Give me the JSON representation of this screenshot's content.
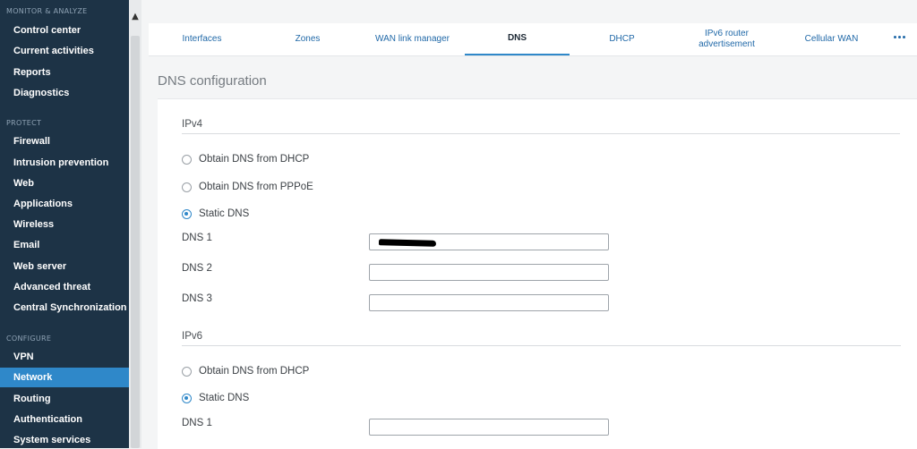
{
  "sidebar": {
    "monitor_section": "MONITOR & ANALYZE",
    "monitor_items": [
      "Control center",
      "Current activities",
      "Reports",
      "Diagnostics"
    ],
    "protect_section": "PROTECT",
    "protect_items": [
      "Firewall",
      "Intrusion prevention",
      "Web",
      "Applications",
      "Wireless",
      "Email",
      "Web server",
      "Advanced threat",
      "Central Synchronization"
    ],
    "configure_section": "CONFIGURE",
    "configure_items": [
      "VPN",
      "Network",
      "Routing",
      "Authentication",
      "System services"
    ],
    "active_item": "Network"
  },
  "tabs": [
    {
      "label": "Interfaces",
      "active": false
    },
    {
      "label": "Zones",
      "active": false
    },
    {
      "label": "WAN link manager",
      "active": false
    },
    {
      "label": "DNS",
      "active": true
    },
    {
      "label": "DHCP",
      "active": false
    },
    {
      "label": "IPv6 router advertisement",
      "active": false
    },
    {
      "label": "Cellular WAN",
      "active": false
    }
  ],
  "page_title": "DNS configuration",
  "ipv4": {
    "label": "IPv4",
    "options": [
      {
        "label": "Obtain DNS from DHCP",
        "selected": false
      },
      {
        "label": "Obtain DNS from PPPoE",
        "selected": false
      },
      {
        "label": "Static DNS",
        "selected": true
      }
    ],
    "fields": [
      {
        "label": "DNS 1",
        "value": "",
        "redacted": true
      },
      {
        "label": "DNS 2",
        "value": ""
      },
      {
        "label": "DNS 3",
        "value": ""
      }
    ]
  },
  "ipv6": {
    "label": "IPv6",
    "options": [
      {
        "label": "Obtain DNS from DHCP",
        "selected": false
      },
      {
        "label": "Static DNS",
        "selected": true
      }
    ],
    "fields": [
      {
        "label": "DNS 1",
        "value": ""
      }
    ]
  },
  "colors": {
    "sidebar_bg": "#1d3346",
    "active_nav": "#2f88c9",
    "tab_text": "#2169a8"
  }
}
